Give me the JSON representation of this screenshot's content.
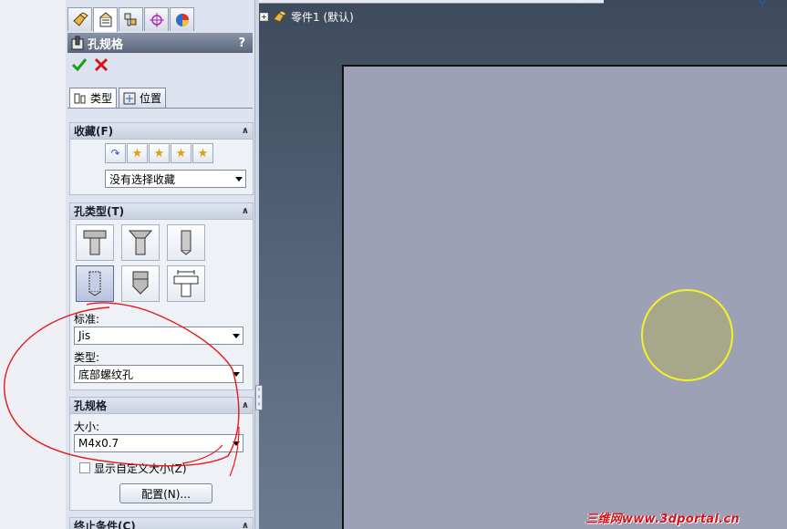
{
  "panel": {
    "title": "孔规格",
    "help": "?",
    "subtabs": [
      {
        "label": "类型"
      },
      {
        "label": "位置"
      }
    ]
  },
  "favorites": {
    "header": "收藏(F)",
    "selected": "没有选择收藏"
  },
  "hole_type": {
    "header": "孔类型(T)",
    "standard_label": "标准:",
    "standard_value": "Jis",
    "type_label": "类型:",
    "type_value": "底部螺纹孔"
  },
  "hole_spec": {
    "header": "孔规格",
    "size_label": "大小:",
    "size_value": "M4x0.7",
    "custom_size_label": "显示自定义大小(Z)",
    "config_button": "配置(N)..."
  },
  "end_condition": {
    "header": "终止条件(C)"
  },
  "tree": {
    "root_label": "零件1 (默认)"
  },
  "watermark": "三维网www.3dportal.cn",
  "colors": {
    "sketch_plane": "#9da1b5",
    "circle_edge": "#f2f22a",
    "annotation": "#e41a1a",
    "panel_header": "#6e788c"
  },
  "icons": [
    "feature-manager-icon",
    "property-manager-icon",
    "configuration-manager-icon",
    "dimxpert-icon",
    "display-manager-icon",
    "hole-wizard-icon",
    "ok-icon",
    "cancel-icon",
    "type-tab-icon",
    "position-tab-icon"
  ]
}
